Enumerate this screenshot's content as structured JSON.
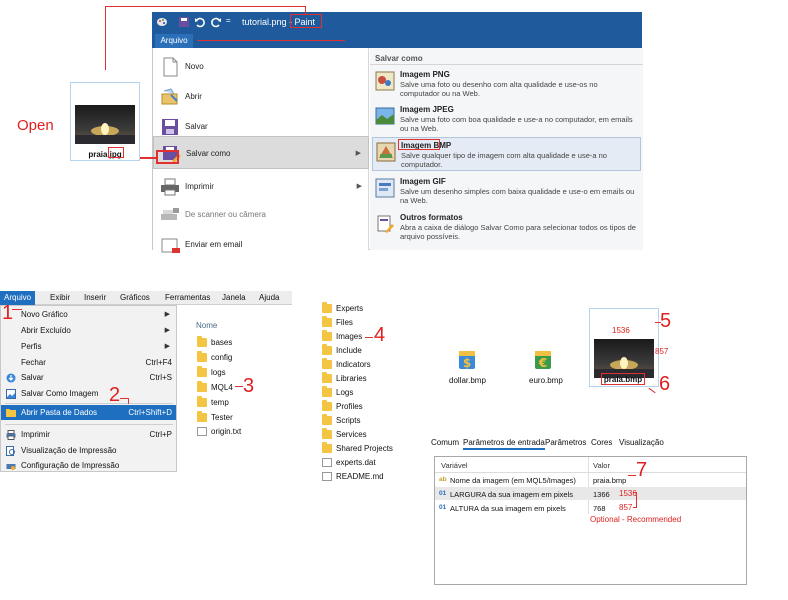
{
  "paint": {
    "title_prefix": "tutorial.png - ",
    "title_app": "Paint",
    "tab_label": "Arquivo",
    "left_items": [
      {
        "label": "Novo",
        "icon": "new-file-icon"
      },
      {
        "label": "Abrir",
        "icon": "open-folder-icon"
      },
      {
        "label": "Salvar",
        "icon": "save-icon"
      },
      {
        "label": "Salvar como",
        "icon": "save-as-icon"
      },
      {
        "label": "Imprimir",
        "icon": "printer-icon"
      },
      {
        "label": "De scanner ou câmera",
        "icon": "scanner-icon"
      },
      {
        "label": "Enviar em email",
        "icon": "email-icon"
      }
    ],
    "save_as_header": "Salvar como",
    "formats": [
      {
        "title": "Imagem PNG",
        "desc": "Salve uma foto ou desenho com alta qualidade e use-os no computador ou na Web."
      },
      {
        "title": "Imagem JPEG",
        "desc": "Salve uma foto com boa qualidade e use-a no computador, em emails ou na Web."
      },
      {
        "title": "Imagem BMP",
        "desc": "Salve qualquer tipo de imagem com alta qualidade e use-a no computador."
      },
      {
        "title": "Imagem GIF",
        "desc": "Salve um desenho simples com baixa qualidade e use-o em emails ou na Web."
      },
      {
        "title": "Outros formatos",
        "desc": "Abra a caixa de diálogo Salvar Como para selecionar todos os tipos de arquivo possíveis."
      }
    ]
  },
  "annotations": {
    "open": "Open",
    "n1": "1",
    "n2": "2",
    "n3": "3",
    "n4": "4",
    "n5": "5",
    "n6": "6",
    "n7": "7",
    "width_label": "1536",
    "height_label": "857",
    "optional": "Optional - Recommended"
  },
  "thumb1": {
    "filename": "praia.jpg"
  },
  "thumb2": {
    "filename": "praia.bmp"
  },
  "mt": {
    "menubar": [
      "Arquivo",
      "Exibir",
      "Inserir",
      "Gráficos",
      "Ferramentas",
      "Janela",
      "Ajuda"
    ],
    "items": [
      {
        "label": "Novo Gráfico",
        "shortcut": "",
        "submenu": true
      },
      {
        "label": "Abrir Excluído",
        "shortcut": "",
        "submenu": true
      },
      {
        "label": "Perfis",
        "shortcut": "",
        "submenu": true
      },
      {
        "label": "Fechar",
        "shortcut": "Ctrl+F4",
        "submenu": false
      },
      {
        "label": "Salvar",
        "shortcut": "Ctrl+S",
        "submenu": false
      },
      {
        "label": "Salvar Como Imagem",
        "shortcut": "",
        "submenu": false
      },
      {
        "label": "Abrir Pasta de Dados",
        "shortcut": "Ctrl+Shift+D",
        "submenu": false
      },
      {
        "label": "Imprimir",
        "shortcut": "Ctrl+P",
        "submenu": false
      },
      {
        "label": "Visualização de Impressão",
        "shortcut": "",
        "submenu": false
      },
      {
        "label": "Configuração de Impressão",
        "shortcut": "",
        "submenu": false
      }
    ]
  },
  "folder1": {
    "header": "Nome",
    "items": [
      {
        "name": "bases",
        "type": "folder"
      },
      {
        "name": "config",
        "type": "folder"
      },
      {
        "name": "logs",
        "type": "folder"
      },
      {
        "name": "MQL4",
        "type": "folder"
      },
      {
        "name": "temp",
        "type": "folder"
      },
      {
        "name": "Tester",
        "type": "folder"
      },
      {
        "name": "origin.txt",
        "type": "file"
      }
    ]
  },
  "folder2": {
    "items": [
      {
        "name": "Experts",
        "type": "folder"
      },
      {
        "name": "Files",
        "type": "folder"
      },
      {
        "name": "Images",
        "type": "folder"
      },
      {
        "name": "Include",
        "type": "folder"
      },
      {
        "name": "Indicators",
        "type": "folder"
      },
      {
        "name": "Libraries",
        "type": "folder"
      },
      {
        "name": "Logs",
        "type": "folder"
      },
      {
        "name": "Profiles",
        "type": "folder"
      },
      {
        "name": "Scripts",
        "type": "folder"
      },
      {
        "name": "Services",
        "type": "folder"
      },
      {
        "name": "Shared Projects",
        "type": "folder"
      },
      {
        "name": "experts.dat",
        "type": "file"
      },
      {
        "name": "README.md",
        "type": "file"
      }
    ]
  },
  "images": {
    "dollar": "dollar.bmp",
    "euro": "euro.bmp"
  },
  "params": {
    "tabs": [
      "Comum",
      "Parâmetros de entrada",
      "Parâmetros",
      "Cores",
      "Visualização"
    ],
    "col_var": "Variável",
    "col_val": "Valor",
    "rows": [
      {
        "icon": "ab",
        "name": "Nome da imagem (em MQL5/Images)",
        "value": "praia.bmp",
        "extra": ""
      },
      {
        "icon": "01",
        "name": "LARGURA da sua imagem em pixels",
        "value": "1366",
        "extra": "1536"
      },
      {
        "icon": "01",
        "name": "ALTURA da sua imagem em pixels",
        "value": "768",
        "extra": "857"
      }
    ]
  },
  "colors": {
    "paint_blue": "#1f5b9c",
    "menu_highlight": "#1f6fc1",
    "annotation_red": "#e02020"
  }
}
